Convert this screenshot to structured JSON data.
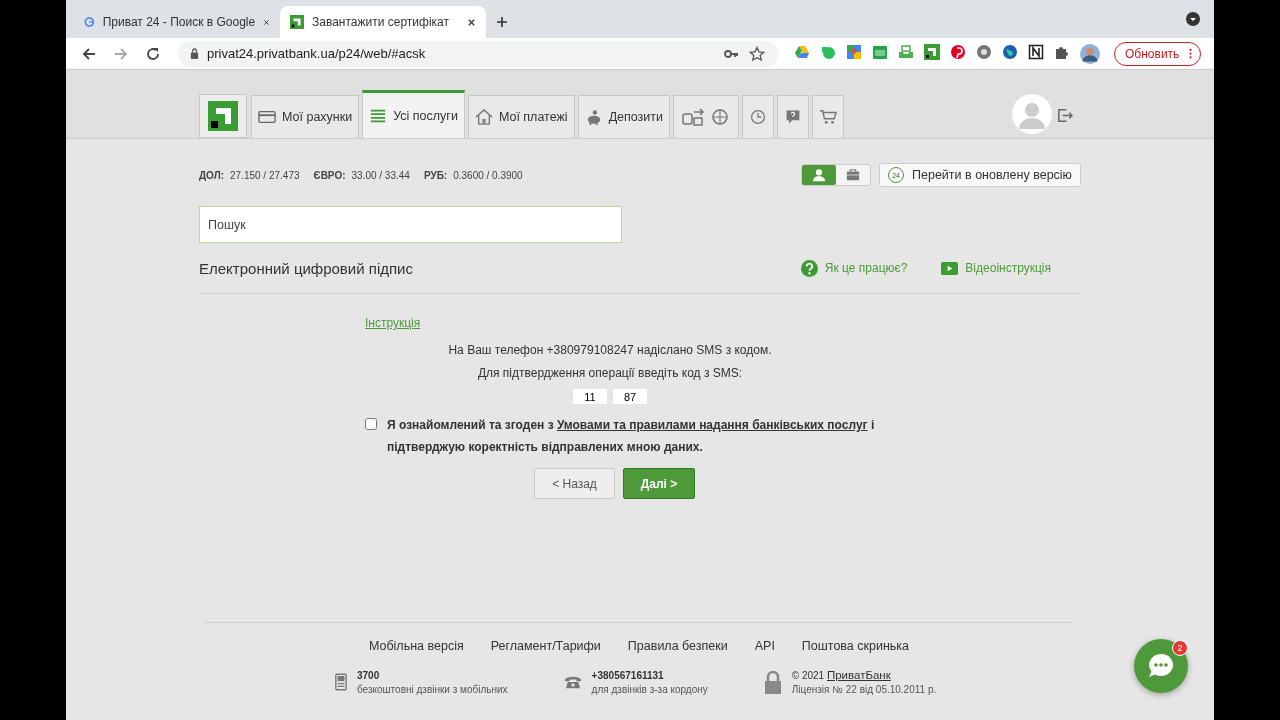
{
  "browser": {
    "tabs": [
      {
        "title": "Приват 24 - Поиск в Google",
        "kind": "google",
        "selected": false
      },
      {
        "title": "Завантажити сертифікат",
        "kind": "privat",
        "selected": true
      }
    ],
    "url": "privat24.privatbank.ua/p24/web/#acsk",
    "update_button": "Обновить"
  },
  "nav": {
    "tabs": [
      {
        "label": "Мої рахунки",
        "kind": "card",
        "selected": false
      },
      {
        "label": "Усі послуги",
        "kind": "list",
        "selected": true
      },
      {
        "label": "Мої платежі",
        "kind": "house",
        "selected": false
      },
      {
        "label": "Депозити",
        "kind": "piggy",
        "selected": false
      },
      {
        "kind": "transport",
        "selected": false
      },
      {
        "kind": "history",
        "selected": false
      },
      {
        "kind": "help",
        "selected": false
      },
      {
        "kind": "cart",
        "selected": false
      }
    ]
  },
  "rates": [
    {
      "label": "ДОЛ:",
      "value": "27.150 / 27.473"
    },
    {
      "label": "ЄВРО:",
      "value": "33.00 / 33.44"
    },
    {
      "label": "РУБ:",
      "value": "0.3600 / 0.3900"
    }
  ],
  "account_toggle": [
    {
      "kind": "person",
      "selected": true
    },
    {
      "kind": "briefcase",
      "selected": false
    }
  ],
  "new_version_button": {
    "badge": "24",
    "label": "Перейти в оновлену версію"
  },
  "search": {
    "placeholder": "Пошук"
  },
  "section": {
    "title": "Електронний цифровий підпис",
    "help_links": [
      {
        "label": "Як це працює?",
        "kind": "question"
      },
      {
        "label": "Відеоінструкція",
        "kind": "video"
      }
    ]
  },
  "form": {
    "instruction_link": "Інструкція",
    "sms_notice": "На Ваш телефон +380979108247 надіслано SMS з кодом.",
    "code_prompt": "Для підтвердження операції введіть код з SMS:",
    "code": [
      "11",
      "87"
    ],
    "agreement": {
      "checked": false,
      "before": "Я ознайомлений та згоден з ",
      "link": "Умовами та правилами надання банківських послуг",
      "after": " і підтверджую коректність відправлених мною даних."
    },
    "back_button": "< Назад",
    "next_button": "Далі >"
  },
  "footer": {
    "links": [
      "Мобільна версія",
      "Регламент/Тарифи",
      "Правила безпеки",
      "API",
      "Поштова скринька"
    ],
    "contacts": [
      {
        "kind": "mobile",
        "title": "3700",
        "caption": "безкоштовні дзвінки з мобільних"
      },
      {
        "kind": "phone",
        "title": "+380567161131",
        "caption": "для дзвінків з-за кордону"
      }
    ],
    "copyright": {
      "prefix": "© 2021 ",
      "link": "ПриватБанк",
      "license": "Ліцензія № 22 від 05.10.2011 р."
    }
  },
  "chat": {
    "badge": "2"
  }
}
